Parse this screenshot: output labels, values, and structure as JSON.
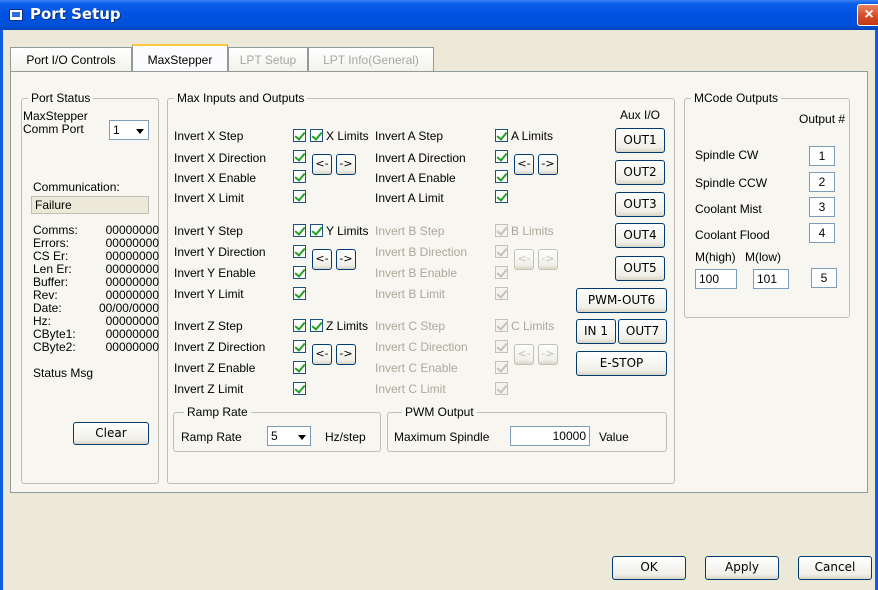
{
  "window": {
    "title": "Port Setup",
    "close_glyph": "×"
  },
  "tabs": [
    {
      "label": "Port I/O Controls",
      "active": false,
      "enabled": true
    },
    {
      "label": "MaxStepper",
      "active": true,
      "enabled": true
    },
    {
      "label": "LPT Setup",
      "active": false,
      "enabled": false
    },
    {
      "label": "LPT Info(General)",
      "active": false,
      "enabled": false
    }
  ],
  "port_status": {
    "legend": "Port Status",
    "comm_port_label": "MaxStepper Comm Port",
    "comm_port_value": "1",
    "communication_label": "Communication:",
    "communication_value": "Failure",
    "stats": [
      {
        "key": "Comms:",
        "value": "00000000"
      },
      {
        "key": "Errors:",
        "value": "00000000"
      },
      {
        "key": "CS  Er:",
        "value": "00000000"
      },
      {
        "key": "Len Er:",
        "value": "00000000"
      },
      {
        "key": "Buffer:",
        "value": "00000000"
      },
      {
        "key": "Rev:",
        "value": "00000000"
      },
      {
        "key": "Date:",
        "value": "00/00/0000"
      },
      {
        "key": "Hz:",
        "value": "00000000"
      },
      {
        "key": "CByte1:",
        "value": "00000000"
      },
      {
        "key": "CByte2:",
        "value": "00000000"
      }
    ],
    "status_msg_label": "Status Msg",
    "clear_label": "Clear"
  },
  "max_io": {
    "legend": "Max Inputs and Outputs",
    "aux_label": "Aux I/O",
    "left_axes": [
      {
        "rows": [
          "Invert X Step",
          "Invert X Direction",
          "Invert X Enable",
          "Invert X Limit"
        ],
        "limits_label": "X Limits",
        "enabled": true
      },
      {
        "rows": [
          "Invert Y Step",
          "Invert Y Direction",
          "Invert Y Enable",
          "Invert Y Limit"
        ],
        "limits_label": "Y Limits",
        "enabled": true
      },
      {
        "rows": [
          "Invert Z Step",
          "Invert Z Direction",
          "Invert Z Enable",
          "Invert Z Limit"
        ],
        "limits_label": "Z Limits",
        "enabled": true
      }
    ],
    "right_axes": [
      {
        "rows": [
          "Invert A Step",
          "Invert A Direction",
          "Invert A Enable",
          "Invert A Limit"
        ],
        "limits_label": "A Limits",
        "enabled": true
      },
      {
        "rows": [
          "Invert B Step",
          "Invert B Direction",
          "Invert B Enable",
          "Invert B Limit"
        ],
        "limits_label": "B Limits",
        "enabled": false
      },
      {
        "rows": [
          "Invert C Step",
          "Invert C Direction",
          "Invert C Enable",
          "Invert C Limit"
        ],
        "limits_label": "C Limits",
        "enabled": false
      }
    ],
    "arrow_left": "<-",
    "arrow_right": "->",
    "aux_buttons": [
      "OUT1",
      "OUT2",
      "OUT3",
      "OUT4",
      "OUT5",
      "PWM-OUT6"
    ],
    "in1_label": "IN 1",
    "out7_label": "OUT7",
    "estop_label": "E-STOP"
  },
  "ramp": {
    "legend": "Ramp Rate",
    "label": "Ramp Rate",
    "value": "5",
    "unit": "Hz/step"
  },
  "pwm": {
    "legend": "PWM Output",
    "label": "Maximum Spindle",
    "value": "10000",
    "unit": "Value"
  },
  "mcode": {
    "legend": "MCode Outputs",
    "output_header": "Output #",
    "rows": [
      {
        "label": "Spindle CW",
        "value": "1"
      },
      {
        "label": "Spindle CCW",
        "value": "2"
      },
      {
        "label": "Coolant Mist",
        "value": "3"
      },
      {
        "label": "Coolant Flood",
        "value": "4"
      }
    ],
    "mhigh_label": "M(high)",
    "mlow_label": "M(low)",
    "mhigh_value": "100",
    "mlow_value": "101",
    "m_output_value": "5"
  },
  "footer": {
    "ok": "OK",
    "apply": "Apply",
    "cancel": "Cancel"
  }
}
